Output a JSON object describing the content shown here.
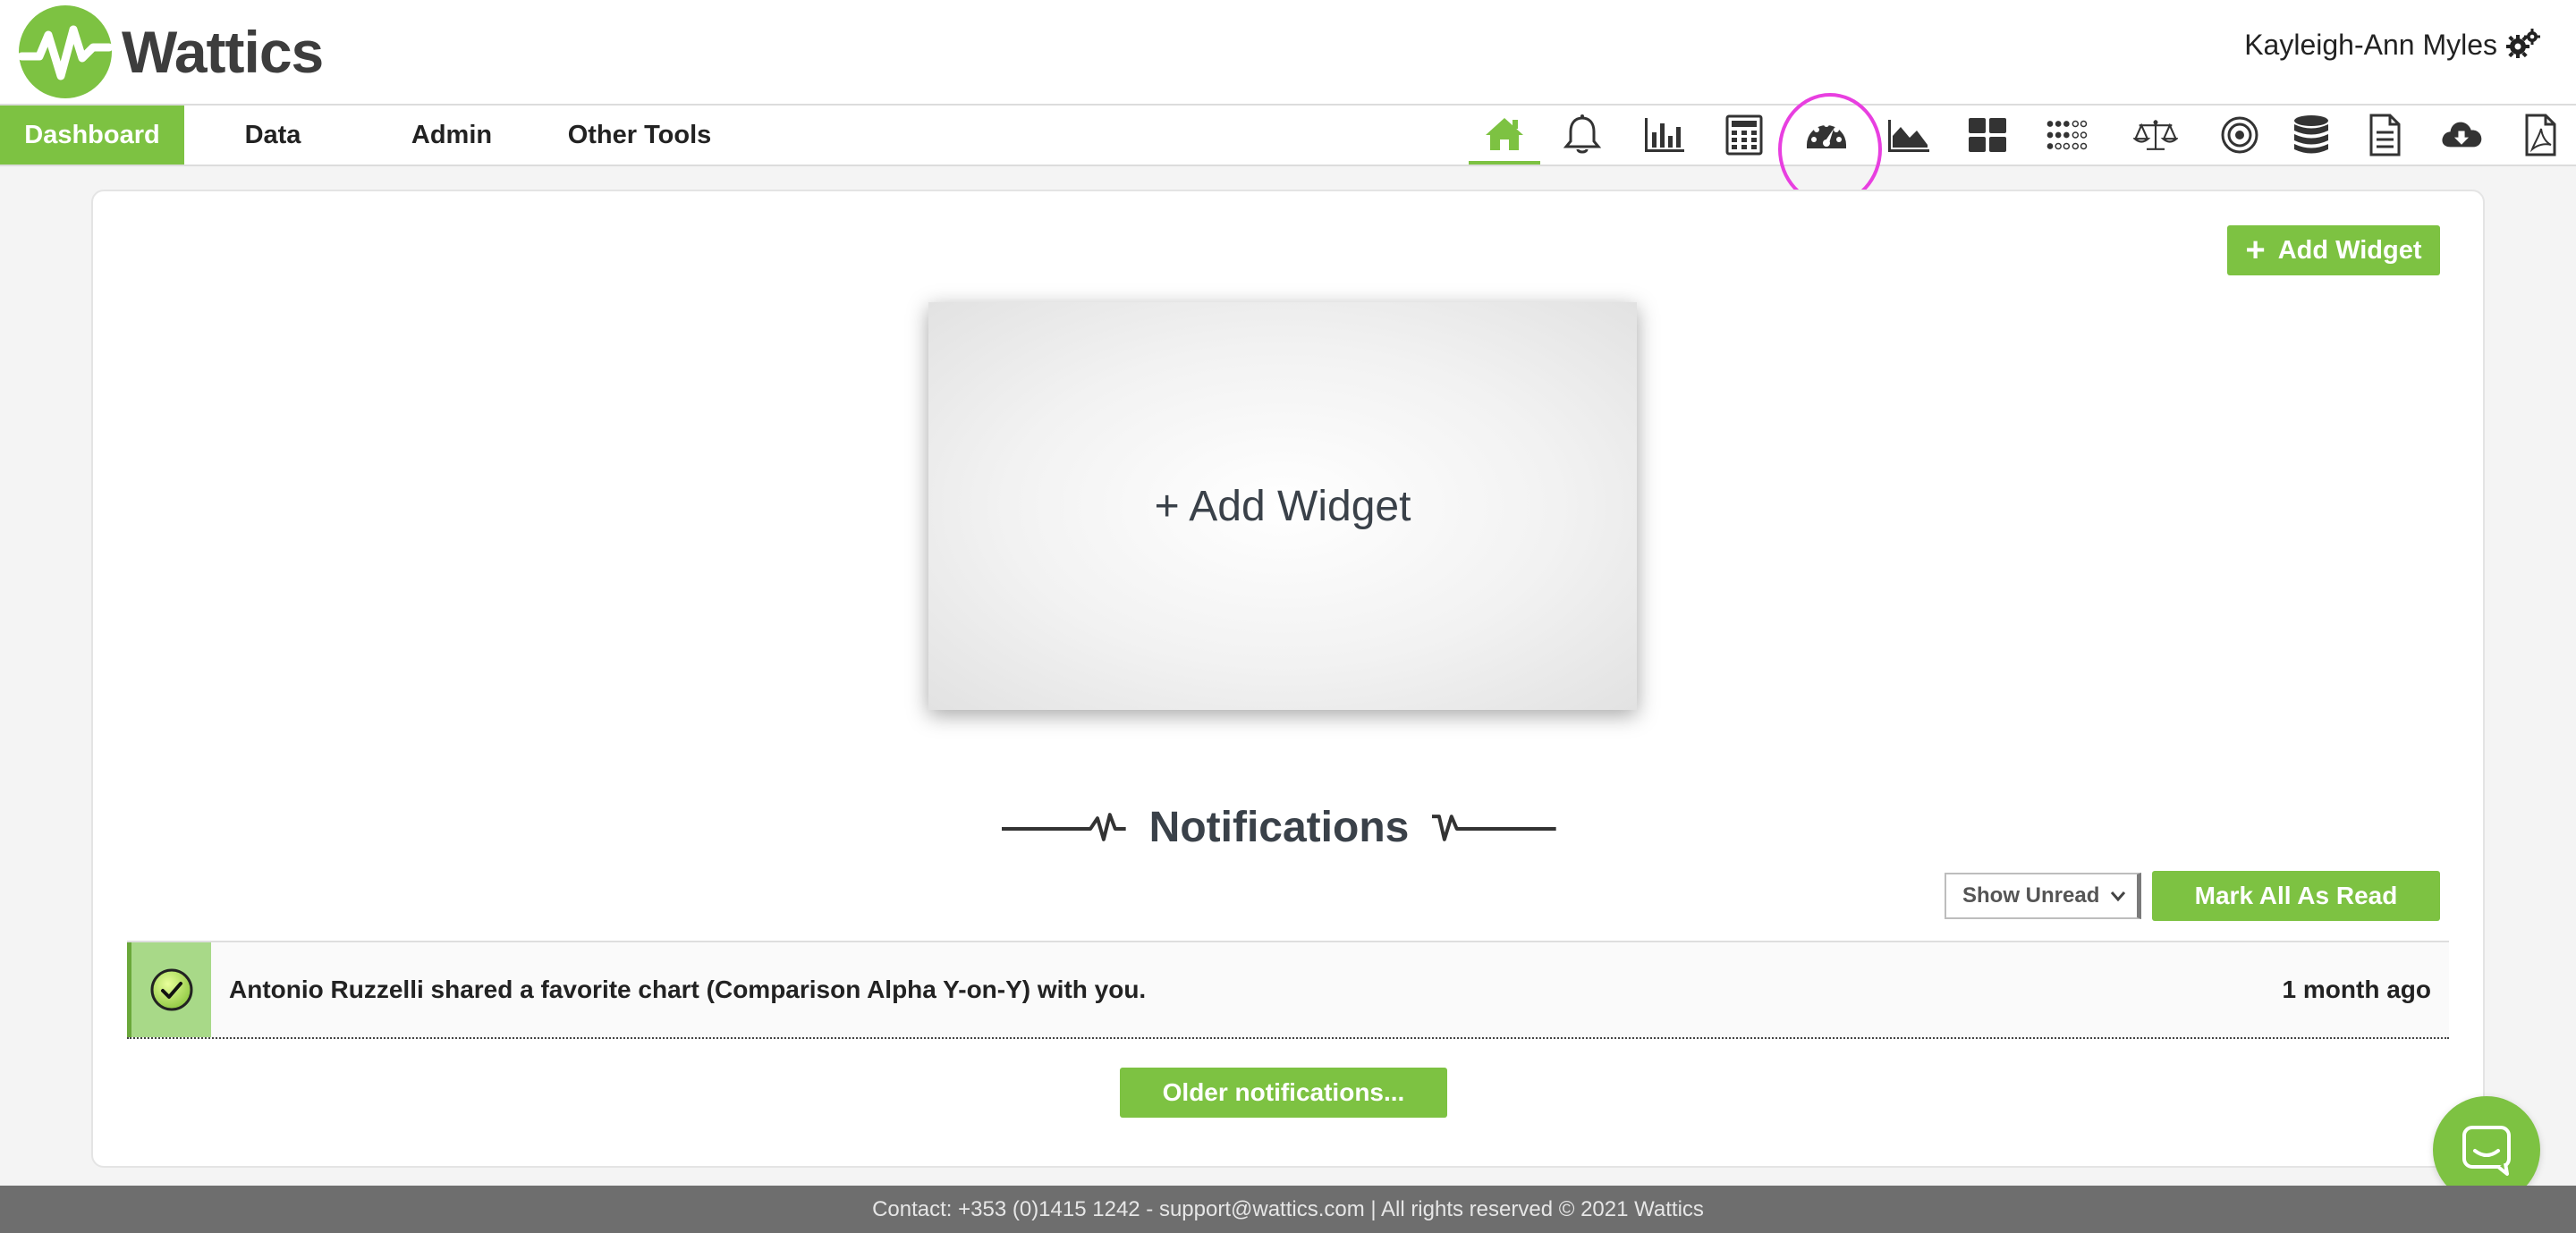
{
  "header": {
    "brand": "Wattics",
    "user_name": "Kayleigh-Ann Myles",
    "user_icon": "gears-icon"
  },
  "nav": {
    "tabs": [
      {
        "label": "Dashboard",
        "active": true
      },
      {
        "label": "Data",
        "active": false
      },
      {
        "label": "Admin",
        "active": false
      },
      {
        "label": "Other Tools",
        "active": false
      }
    ],
    "icons": [
      {
        "name": "home-icon",
        "active": true
      },
      {
        "name": "bell-icon",
        "active": false
      },
      {
        "name": "bar-chart-icon",
        "active": false
      },
      {
        "name": "calculator-icon",
        "active": false
      },
      {
        "name": "dashboard-gauge-icon",
        "active": false,
        "highlighted": true
      },
      {
        "name": "area-chart-icon",
        "active": false
      },
      {
        "name": "grid-icon",
        "active": false
      },
      {
        "name": "dots-grid-icon",
        "active": false
      },
      {
        "name": "balance-scale-icon",
        "active": false
      },
      {
        "name": "target-icon",
        "active": false
      },
      {
        "name": "database-icon",
        "active": false
      },
      {
        "name": "document-icon",
        "active": false
      },
      {
        "name": "cloud-download-icon",
        "active": false
      },
      {
        "name": "pdf-icon",
        "active": false
      }
    ]
  },
  "main": {
    "add_widget_button": "Add Widget",
    "add_widget_plus": "+",
    "widget_placeholder_label": "+ Add Widget"
  },
  "notifications": {
    "heading": "Notifications",
    "filter_selected": "Show Unread",
    "mark_all_label": "Mark All As Read",
    "items": [
      {
        "message": "Antonio Ruzzelli shared a favorite chart (Comparison Alpha Y-on-Y) with you.",
        "time": "1 month ago",
        "status": "read-check"
      }
    ],
    "older_label": "Older notifications..."
  },
  "footer": {
    "text": "Contact: +353 (0)1415 1242 - support@wattics.com | All rights reserved © 2021 Wattics"
  },
  "colors": {
    "accent": "#7dc242",
    "annotation": "#e83fe0",
    "footer_bg": "#6e6e6e",
    "text_dark": "#3a4149"
  }
}
